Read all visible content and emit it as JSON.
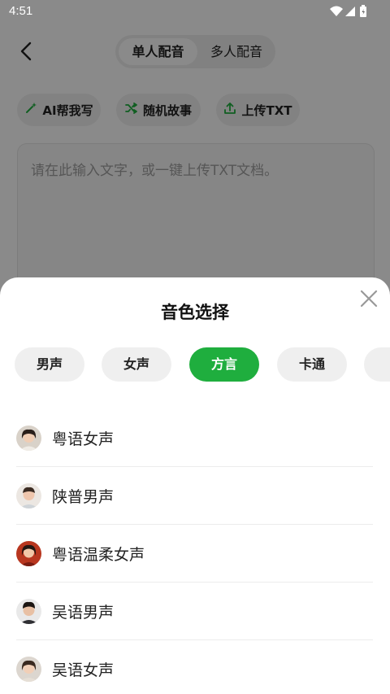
{
  "status_bar": {
    "time": "4:51"
  },
  "header": {
    "segments": [
      {
        "label": "单人配音"
      },
      {
        "label": "多人配音"
      }
    ]
  },
  "toolbar": {
    "chips": [
      {
        "label": "AI帮我写",
        "icon": "sparkle-pen-icon"
      },
      {
        "label": "随机故事",
        "icon": "shuffle-icon"
      },
      {
        "label": "上传TXT",
        "icon": "upload-icon"
      }
    ]
  },
  "editor": {
    "placeholder": "请在此输入文字，或一键上传TXT文档。"
  },
  "sheet": {
    "title": "音色选择",
    "tabs": [
      {
        "label": "男声"
      },
      {
        "label": "女声"
      },
      {
        "label": "方言"
      },
      {
        "label": "卡通"
      }
    ],
    "voices": [
      {
        "name": "粤语女声"
      },
      {
        "name": "陕普男声"
      },
      {
        "name": "粤语温柔女声"
      },
      {
        "name": "吴语男声"
      },
      {
        "name": "吴语女声"
      }
    ]
  },
  "colors": {
    "accent": "#1fae3e",
    "overlay": "rgba(0,0,0,0.46)"
  }
}
